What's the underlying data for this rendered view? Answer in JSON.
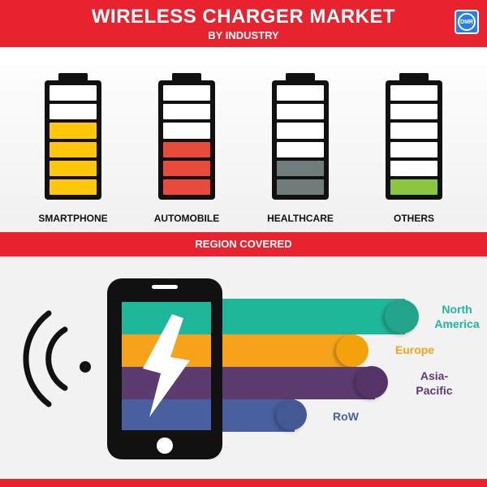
{
  "header": {
    "title": "WIRELESS CHARGER MARKET",
    "subtitle": "BY INDUSTRY",
    "logo_icon": "dmr-logo-icon"
  },
  "industries": [
    {
      "label": "SMARTPHONE",
      "color": "#ffc60a",
      "filled_cells": 4,
      "total_cells": 6
    },
    {
      "label": "AUTOMOBILE",
      "color": "#e84a3c",
      "filled_cells": 3,
      "total_cells": 6
    },
    {
      "label": "HEALTHCARE",
      "color": "#707b7b",
      "filled_cells": 2,
      "total_cells": 6
    },
    {
      "label": "OTHERS",
      "color": "#8cc63f",
      "filled_cells": 1,
      "total_cells": 6
    }
  ],
  "region_band": {
    "label": "REGION COVERED"
  },
  "regions": [
    {
      "label": "North\nAmerica",
      "color": "#1fb79a",
      "end_color": "#23a48a"
    },
    {
      "label": "Europe",
      "color": "#f7a21b",
      "end_color": "#f4a20c"
    },
    {
      "label": "Asia-\nPacific",
      "color": "#5c3b6e",
      "end_color": "#553366"
    },
    {
      "label": "RoW",
      "color": "#4a5fa0",
      "end_color": "#445894"
    }
  ],
  "colors": {
    "brand_red": "#e8232f",
    "battery_frame": "#111111",
    "phone_body": "#111111"
  },
  "icons": {
    "phone": "smartphone-icon",
    "bolt": "lightning-bolt-icon",
    "waves": "wireless-signal-icon"
  }
}
